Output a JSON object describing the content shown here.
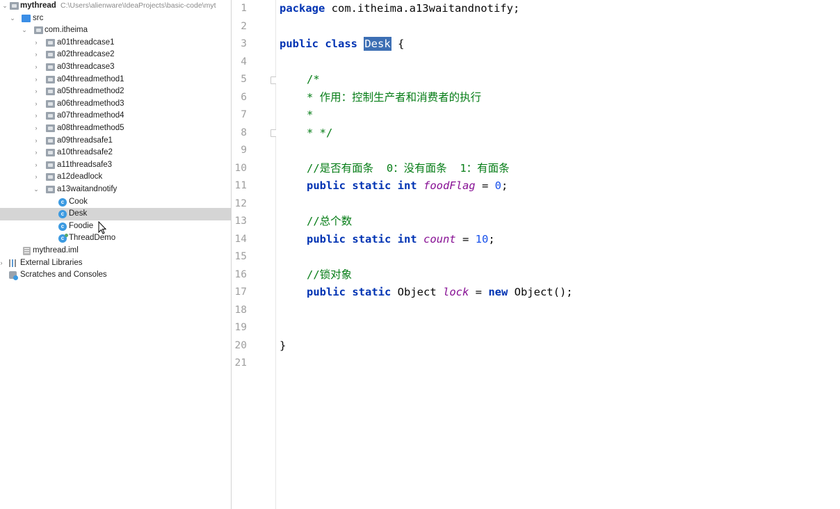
{
  "project": {
    "name": "mythread",
    "path": "C:\\Users\\alienware\\IdeaProjects\\basic-code\\myt",
    "src": "src",
    "package": "com.itheima",
    "folders": [
      "a01threadcase1",
      "a02threadcase2",
      "a03threadcase3",
      "a04threadmethod1",
      "a05threadmethod2",
      "a06threadmethod3",
      "a07threadmethod4",
      "a08threadmethod5",
      "a09threadsafe1",
      "a10threadsafe2",
      "a11threadsafe3",
      "a12deadlock",
      "a13waitandnotify"
    ],
    "classes": [
      "Cook",
      "Desk",
      "Foodie",
      "ThreadDemo"
    ],
    "iml": "mythread.iml",
    "external_libraries": "External Libraries",
    "scratches": "Scratches and Consoles"
  },
  "editor": {
    "line_numbers": [
      "1",
      "2",
      "3",
      "4",
      "5",
      "6",
      "7",
      "8",
      "9",
      "10",
      "11",
      "12",
      "13",
      "14",
      "15",
      "16",
      "17",
      "18",
      "19",
      "20",
      "21"
    ],
    "code": {
      "l1_kw": "package",
      "l1_rest": " com.itheima.a13waitandnotify;",
      "l3_kw": "public class",
      "l3_name": "Desk",
      "l3_rest": " {",
      "l5": "/*",
      "l6": "* 作用：控制生产者和消费者的执行",
      "l7": "*",
      "l8": "* */",
      "l10": "//是否有面条  0：没有面条  1：有面条",
      "l11_kw": "public static int",
      "l11_field": "foodFlag",
      "l11_eq": " = ",
      "l11_num": "0",
      "l11_end": ";",
      "l13": "//总个数",
      "l14_kw": "public static int",
      "l14_field": "count",
      "l14_eq": " = ",
      "l14_num": "10",
      "l14_end": ";",
      "l16": "//锁对象",
      "l17_kw": "public static",
      "l17_type": " Object ",
      "l17_field": "lock",
      "l17_eq": " = ",
      "l17_new": "new",
      "l17_end": " Object();",
      "l20": "}"
    }
  },
  "colors": {
    "keyword": "#0033b3",
    "comment": "#067d17",
    "field": "#871094",
    "number": "#1750eb",
    "selection": "#3d6fb4",
    "current_line": "#fffae3"
  }
}
